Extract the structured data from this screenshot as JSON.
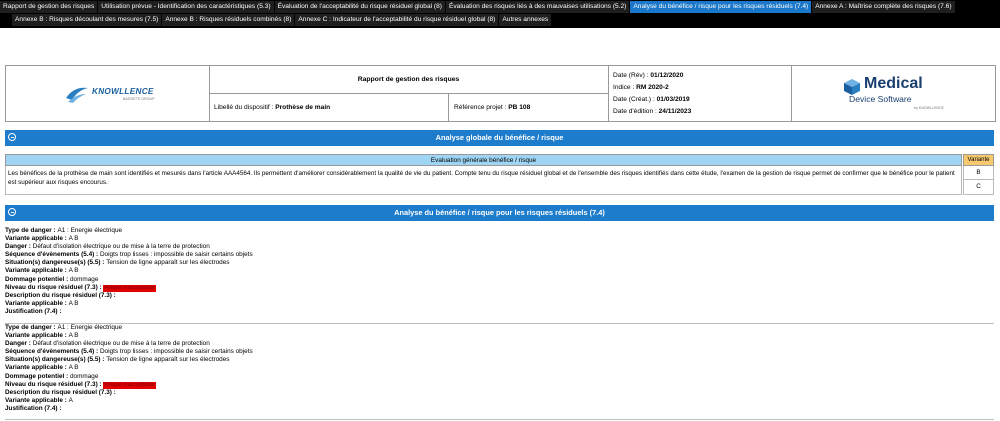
{
  "tabs_row1": [
    "Rapport de gestion des risques",
    "Utilisation prévue - Identification des caractéristiques (5.3)",
    "Évaluation de l'acceptabilité du risque résiduel global (8)",
    "Évaluation des risques liés à des mauvaises utilisations (5.2)",
    "Analyse du bénéfice / risque pour les risques résiduels (7.4)",
    "Annexe A : Maîtrise complète des risques (7.6)"
  ],
  "tabs_row2": [
    "Annexe B : Risques découlant des mesures (7.5)",
    "Annexe B : Risques résiduels combinés (8)",
    "Annexe C : Indicateur de l'acceptabilité du risque résiduel global (8)",
    "Autres annexes"
  ],
  "active_tab": "Analyse du bénéfice / risque pour les risques résiduels (7.4)",
  "header": {
    "left_logo": {
      "name": "KNOWLLENCE",
      "sub": "BASSETTI GROUP"
    },
    "report_title": "Rapport de gestion des risques",
    "device_label": "Libellé du dispositif : ",
    "device_value": "Prothèse de main",
    "ref_label": "Référence projet : ",
    "ref_value": "PB 108",
    "dates": [
      {
        "label": "Date (Rév) : ",
        "value": "01/12/2020"
      },
      {
        "label": "Indice : ",
        "value": "RM 2020-2"
      },
      {
        "label": "Date (Créat.) : ",
        "value": "01/03/2019"
      },
      {
        "label": "Date d'édition : ",
        "value": "24/11/2023"
      }
    ],
    "right_logo": {
      "line1": "Medical",
      "line2": "Device Software",
      "line3": "by KNOWLLENCE"
    }
  },
  "section1": {
    "title": "Analyse globale du bénéfice / risque",
    "eval_header": "Evaluation générale bénéfice / risque",
    "variant_header": "Variante",
    "text": "Les bénéfices de la prothèse de main sont identifiés et mesurés dans l'article AAA4564. Ils permettent d'améliorer considérablement la qualité de vie du patient. Compte tenu du risque résiduel global et de l'ensemble des risques identifiés dans cette étude, l'examen de la gestion de risque permet de confirmer que le bénéfice pour le patient est supérieur aux risques encourus.",
    "variants": [
      "B",
      "C"
    ]
  },
  "section2": {
    "title": "Analyse du bénéfice / risque pour les risques résiduels (7.4)",
    "entries": [
      {
        "type_label": "Type de danger : ",
        "type_value": "A1 : Energie électrique",
        "var1_label": "Variante applicable : ",
        "var1_value": "A B",
        "danger_label": "Danger : ",
        "danger_value": "Défaut d'isolation électrique ou de mise à la terre de protection",
        "seq_label": "Séquence d'évènements (5.4) : ",
        "seq_value": "Doigts trop lisses : impossible de saisir certains objets",
        "sit_label": "Situation(s) dangereuse(s) (5.5) : ",
        "sit_value": "Tension de ligne apparaît sur les électrodes",
        "var2_label": "Variante applicable : ",
        "var2_value": "A B",
        "dmg_label": "Dommage potentiel : ",
        "dmg_value": "dommage",
        "lvl_label": "Niveau du risque résiduel (7.3) : ",
        "lvl_value": "Risque inacceptable",
        "desc_label": "Description du risque résiduel (7.3) : ",
        "var3_label": "Variante applicable : ",
        "var3_value": "A B",
        "just_label": "Justification (7.4) : "
      },
      {
        "type_label": "Type de danger : ",
        "type_value": "A1 : Energie électrique",
        "var1_label": "Variante applicable : ",
        "var1_value": "A B",
        "danger_label": "Danger : ",
        "danger_value": "Défaut d'isolation électrique ou de mise à la terre de protection",
        "seq_label": "Séquence d'évènements (5.4) : ",
        "seq_value": "Doigts trop lisses : impossible de saisir certains objets",
        "sit_label": "Situation(s) dangereuse(s) (5.5) : ",
        "sit_value": "Tension de ligne apparaît sur les électrodes",
        "var2_label": "Variante applicable : ",
        "var2_value": "A B",
        "dmg_label": "Dommage potentiel : ",
        "dmg_value": "dommage",
        "lvl_label": "Niveau du risque résiduel (7.3) : ",
        "lvl_value": "Risque inacceptable",
        "desc_label": "Description du risque résiduel (7.3) : ",
        "var3_label": "Variante applicable : ",
        "var3_value": "A",
        "just_label": "Justification (7.4) : "
      }
    ]
  },
  "colors": {
    "tabbar": "#000000",
    "active_tab": "#1b77c9",
    "section": "#1d7ccb",
    "eval_header": "#9fd4f3",
    "variant_header": "#f7c86e",
    "risk": "#e00000"
  }
}
